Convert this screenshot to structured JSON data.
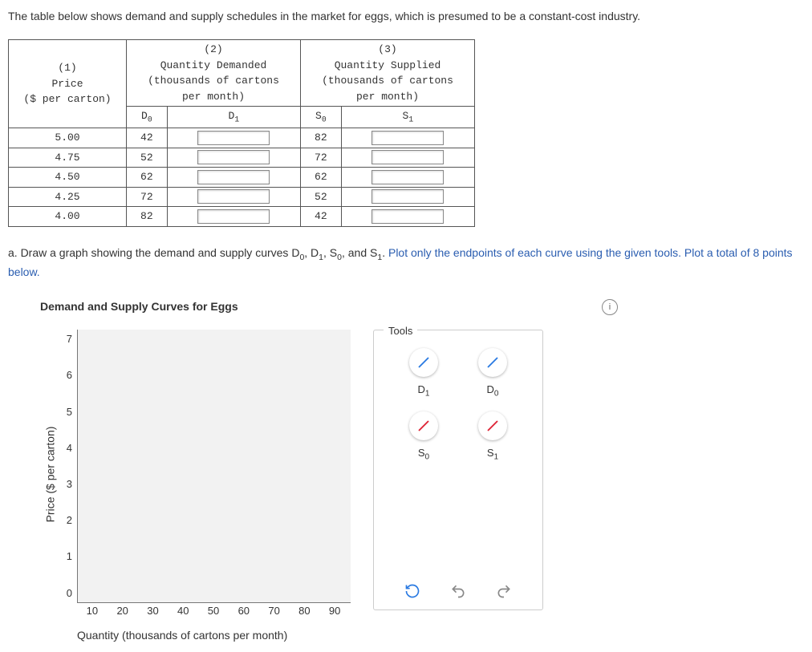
{
  "intro": "The table below shows demand and supply schedules in the market for eggs, which is presumed to be a constant-cost industry.",
  "table": {
    "headers": {
      "col1_num": "(1)",
      "col1_a": "Price",
      "col1_b": "($ per carton)",
      "col2_num": "(2)",
      "col2_a": "Quantity Demanded",
      "col2_b": "(thousands of cartons",
      "col2_c": "per month)",
      "col3_num": "(3)",
      "col3_a": "Quantity Supplied",
      "col3_b": "(thousands of cartons",
      "col3_c": "per month)",
      "sub_d0_pre": "D",
      "sub_d0_sub": "0",
      "sub_d1_pre": "D",
      "sub_d1_sub": "1",
      "sub_s0_pre": "S",
      "sub_s0_sub": "0",
      "sub_s1_pre": "S",
      "sub_s1_sub": "1"
    },
    "rows": [
      {
        "price": "5.00",
        "d0": "42",
        "s0": "82"
      },
      {
        "price": "4.75",
        "d0": "52",
        "s0": "72"
      },
      {
        "price": "4.50",
        "d0": "62",
        "s0": "62"
      },
      {
        "price": "4.25",
        "d0": "72",
        "s0": "52"
      },
      {
        "price": "4.00",
        "d0": "82",
        "s0": "42"
      }
    ]
  },
  "question": {
    "prefix": "a. Draw a graph showing the demand and supply curves D",
    "s0": "0",
    "mid1": ", D",
    "s1": "1",
    "mid2": ", S",
    "s2": "0",
    "mid3": ", and S",
    "s3": "1",
    "period": ". ",
    "blue": "Plot only the endpoints of each curve using the given tools. Plot a total of 8 points below."
  },
  "chart": {
    "title": "Demand and Supply Curves for Eggs",
    "ylabel": "Price ($ per carton)",
    "xlabel": "Quantity (thousands of cartons per month)",
    "yticks": [
      "7",
      "6",
      "5",
      "4",
      "3",
      "2",
      "1",
      "0"
    ],
    "xticks": [
      "10",
      "20",
      "30",
      "40",
      "50",
      "60",
      "70",
      "80",
      "90"
    ]
  },
  "tools": {
    "legend": "Tools",
    "items": [
      {
        "label_pre": "D",
        "label_sub": "1",
        "color": "#2a7ae2"
      },
      {
        "label_pre": "D",
        "label_sub": "0",
        "color": "#2a7ae2"
      },
      {
        "label_pre": "S",
        "label_sub": "0",
        "color": "#d23"
      },
      {
        "label_pre": "S",
        "label_sub": "1",
        "color": "#d23"
      }
    ]
  },
  "chart_data": {
    "type": "line",
    "title": "Demand and Supply Curves for Eggs",
    "xlabel": "Quantity (thousands of cartons per month)",
    "ylabel": "Price ($ per carton)",
    "xlim": [
      0,
      90
    ],
    "ylim": [
      0,
      7
    ],
    "series": []
  }
}
